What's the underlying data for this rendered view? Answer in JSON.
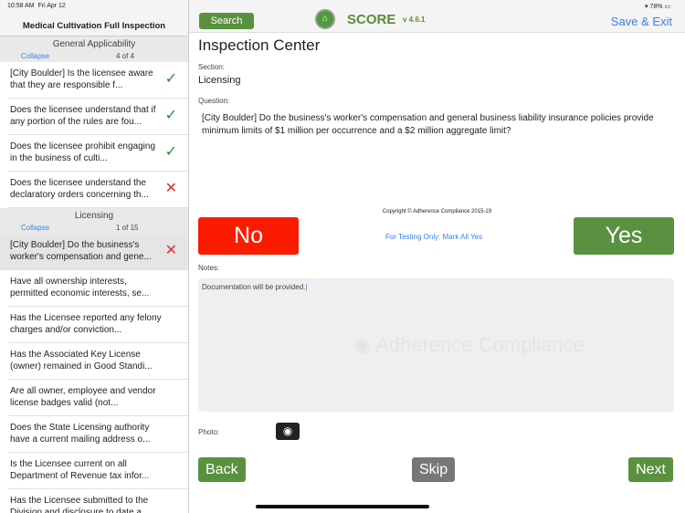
{
  "status": {
    "time": "10:58 AM",
    "date": "Fri Apr 12",
    "battery": "78%"
  },
  "sidebar": {
    "title": "Medical Cultivation Full Inspection",
    "sections": [
      {
        "name": "General Applicability",
        "collapse": "Collapse",
        "count": "4 of 4",
        "items": [
          {
            "text": "[City Boulder] Is the licensee aware that they are responsible f...",
            "status": "pass"
          },
          {
            "text": "Does the licensee understand that if any portion of the rules are fou...",
            "status": "pass"
          },
          {
            "text": "Does the licensee prohibit engaging in the business of culti...",
            "status": "pass"
          },
          {
            "text": "Does the licensee understand the declaratory orders concerning th...",
            "status": "fail"
          }
        ]
      },
      {
        "name": "Licensing",
        "collapse": "Collapse",
        "count": "1 of 15",
        "items": [
          {
            "text": "[City Boulder] Do the business's worker's compensation and gene...",
            "status": "fail"
          },
          {
            "text": "Have all ownership interests, permitted economic interests, se...",
            "status": ""
          },
          {
            "text": "Has the Licensee reported any felony charges and/or conviction...",
            "status": ""
          },
          {
            "text": "Has the Associated Key License (owner) remained in Good Standi...",
            "status": ""
          },
          {
            "text": "Are all owner, employee and vendor license badges valid (not...",
            "status": ""
          },
          {
            "text": "Does the State Licensing authority have a current mailing address o...",
            "status": ""
          },
          {
            "text": "Is the Licensee current on all Department of Revenue tax infor...",
            "status": ""
          },
          {
            "text": "Has the Licensee submitted to the Division and disclosure to date a...",
            "status": ""
          }
        ]
      }
    ]
  },
  "header": {
    "search": "Search",
    "app": "SCORE",
    "version": "v 4.6.1",
    "save_exit": "Save & Exit"
  },
  "main": {
    "title": "Inspection Center",
    "section_label": "Section:",
    "section": "Licensing",
    "question_label": "Question:",
    "question": "[City Boulder] Do the business's worker's compensation and general business liability insurance policies provide minimum limits of $1 million per occurrence and a $2 million aggregate limit?",
    "copyright": "Copyright © Adherence Compliance 2015-19",
    "no": "No",
    "yes": "Yes",
    "test": "For Testing Only: Mark All Yes",
    "notes_label": "Notes:",
    "notes": "Documentation will be provided.",
    "watermark": "Adherence Compliance",
    "photo_label": "Photo:",
    "back": "Back",
    "skip": "Skip",
    "next": "Next"
  }
}
